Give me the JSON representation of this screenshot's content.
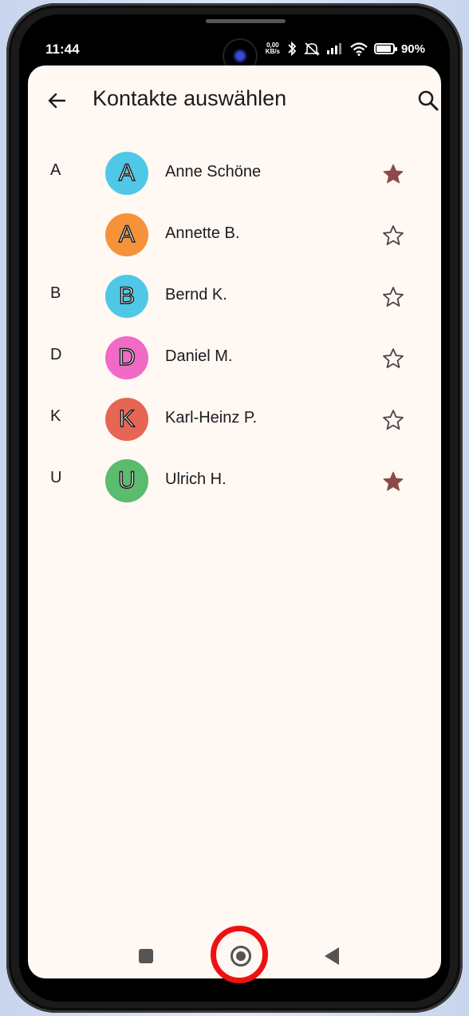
{
  "status": {
    "time": "11:44",
    "net_speed_top": "0,00",
    "net_speed_bottom": "KB/s",
    "battery": "90%"
  },
  "appbar": {
    "title": "Kontakte auswählen",
    "back_icon": "arrow-left-icon",
    "search_icon": "search-icon"
  },
  "contacts": [
    {
      "letter": "A",
      "initial": "A",
      "name": "Anne Schöne",
      "color": "#4fc8e8",
      "starred": true
    },
    {
      "letter": "",
      "initial": "A",
      "name": "Annette B.",
      "color": "#f5923a",
      "starred": false
    },
    {
      "letter": "B",
      "initial": "B",
      "name": "Bernd K.",
      "color": "#4fc8e8",
      "starred": false
    },
    {
      "letter": "D",
      "initial": "D",
      "name": "Daniel M.",
      "color": "#f06ac6",
      "starred": false
    },
    {
      "letter": "K",
      "initial": "K",
      "name": "Karl-Heinz P.",
      "color": "#e66555",
      "starred": false
    },
    {
      "letter": "U",
      "initial": "U",
      "name": "Ulrich H.",
      "color": "#5bbb6e",
      "starred": true
    }
  ],
  "colors": {
    "star_filled": "#8b4a48",
    "star_outline": "#4a4446",
    "highlight": "#ee1111"
  }
}
